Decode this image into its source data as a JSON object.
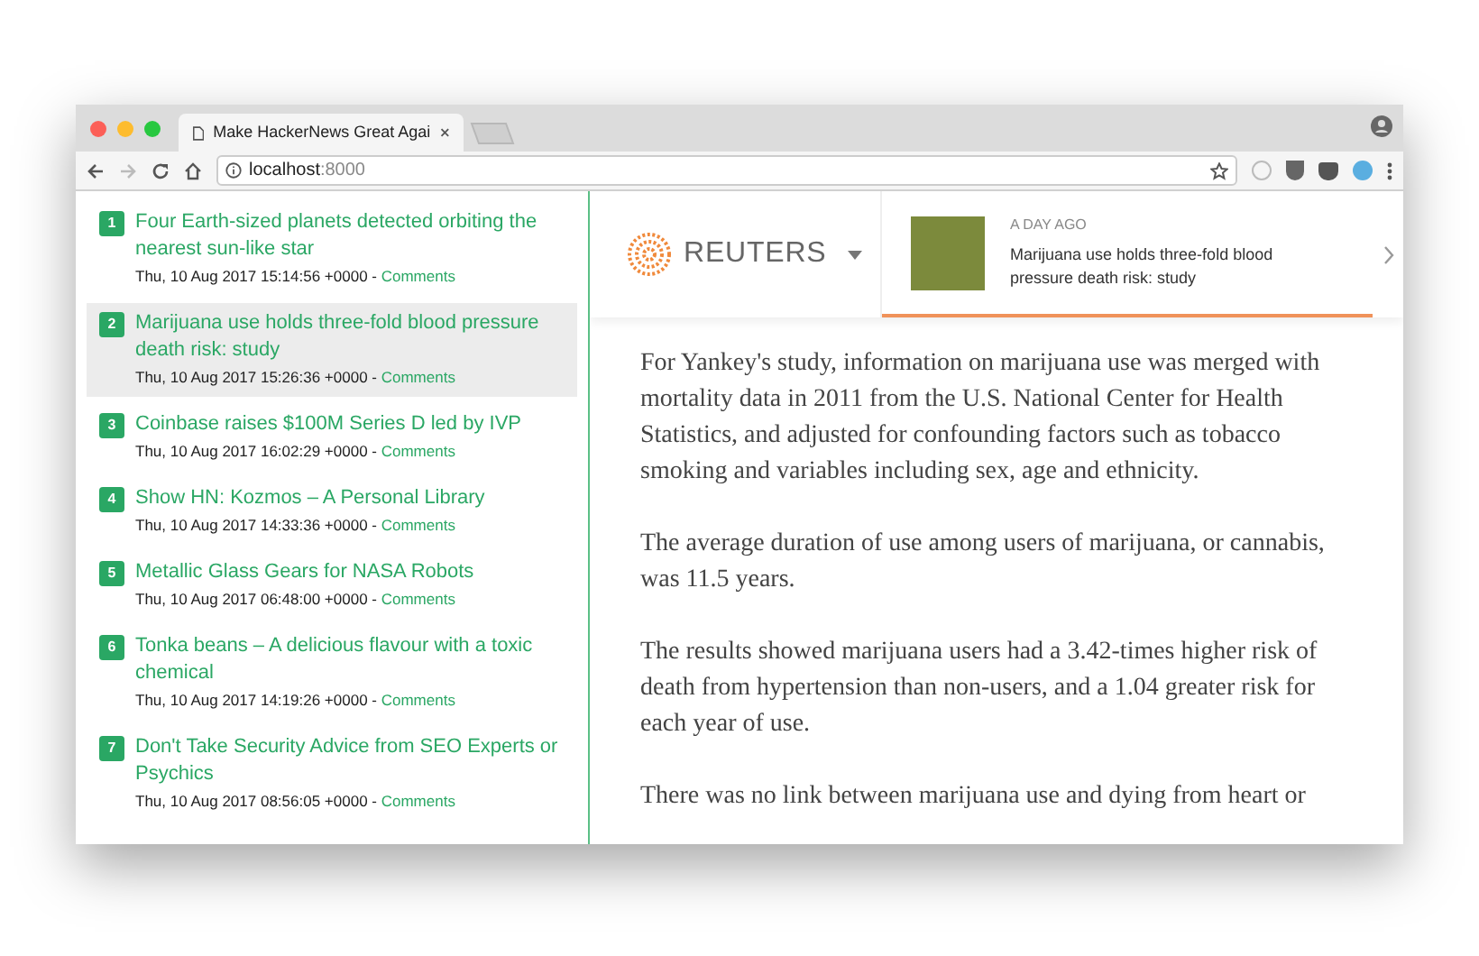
{
  "window": {
    "tab_title": "Make HackerNews Great Agai",
    "address": {
      "host": "localhost",
      "port": ":8000"
    }
  },
  "stories": [
    {
      "rank": "1",
      "title": "Four Earth-sized planets detected orbiting the nearest sun-like star",
      "date": "Thu, 10 Aug 2017 15:14:56 +0000",
      "separator": " - ",
      "comments": "Comments",
      "selected": false
    },
    {
      "rank": "2",
      "title": "Marijuana use holds three-fold blood pressure death risk: study",
      "date": "Thu, 10 Aug 2017 15:26:36 +0000",
      "separator": " - ",
      "comments": "Comments",
      "selected": true
    },
    {
      "rank": "3",
      "title": "Coinbase raises $100M Series D led by IVP",
      "date": "Thu, 10 Aug 2017 16:02:29 +0000",
      "separator": " - ",
      "comments": "Comments",
      "selected": false
    },
    {
      "rank": "4",
      "title": "Show HN: Kozmos – A Personal Library",
      "date": "Thu, 10 Aug 2017 14:33:36 +0000",
      "separator": " - ",
      "comments": "Comments",
      "selected": false
    },
    {
      "rank": "5",
      "title": "Metallic Glass Gears for NASA Robots",
      "date": "Thu, 10 Aug 2017 06:48:00 +0000",
      "separator": " - ",
      "comments": "Comments",
      "selected": false
    },
    {
      "rank": "6",
      "title": "Tonka beans – A delicious flavour with a toxic chemical",
      "date": "Thu, 10 Aug 2017 14:19:26 +0000",
      "separator": " - ",
      "comments": "Comments",
      "selected": false
    },
    {
      "rank": "7",
      "title": "Don't Take Security Advice from SEO Experts or Psychics",
      "date": "Thu, 10 Aug 2017 08:56:05 +0000",
      "separator": " - ",
      "comments": "Comments",
      "selected": false
    }
  ],
  "article": {
    "site": "REUTERS",
    "teaser": {
      "time": "A DAY AGO",
      "headline": "Marijuana use holds three-fold blood pressure death risk: study"
    },
    "paragraphs": [
      "For Yankey's study, information on marijuana use was merged with mortality data in 2011 from the U.S. National Center for Health Statistics, and adjusted for confounding factors such as tobacco smoking and variables including sex, age and ethnicity.",
      "The average duration of use among users of marijuana, or cannabis, was 11.5 years.",
      "The results showed marijuana users had a 3.42-times higher risk of death from hypertension than non-users, and a 1.04 greater risk for each year of use.",
      "There was no link between marijuana use and dying from heart or"
    ]
  }
}
